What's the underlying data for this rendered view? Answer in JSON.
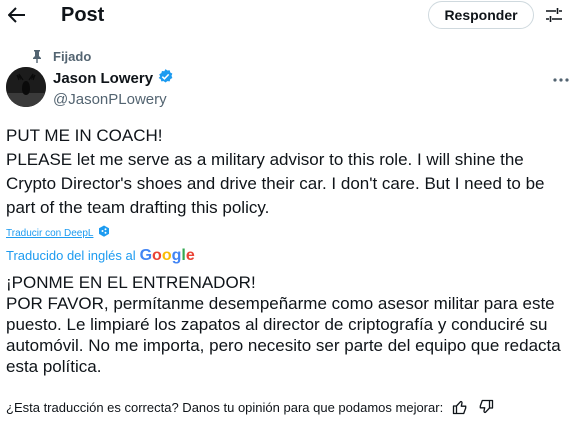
{
  "header": {
    "title": "Post",
    "reply_label": "Responder"
  },
  "pinned_label": "Fijado",
  "author": {
    "name": "Jason Lowery",
    "handle": "@JasonPLowery"
  },
  "tweet": {
    "line1": "PUT ME IN COACH!",
    "line2": "PLEASE let me serve as a military advisor to this role. I will shine the Crypto Director's shoes and drive their car. I don't care. But I need to be part of the team drafting this policy."
  },
  "translate_link": "Traducir con DeepL",
  "translated_from": "Traducido del inglés al",
  "google_logo": "Google",
  "translation": {
    "line1": "¡PONME EN EL ENTRENADOR!",
    "line2": "POR FAVOR, permítanme desempeñarme como asesor militar para este puesto. Le limpiaré los zapatos al director de criptografía y conduciré su automóvil. No me importa, pero necesito ser parte del equipo que redacta esta política."
  },
  "feedback_prompt": "¿Esta traducción es correcta? Danos tu opinión para que podamos mejorar:",
  "colors": {
    "accent": "#1d9bf0",
    "muted": "#536471",
    "text": "#0f1419",
    "border": "#cfd9de"
  },
  "icons": [
    "back-arrow-icon",
    "tune-icon",
    "pin-icon",
    "verified-badge-icon",
    "more-icon",
    "deepl-icon",
    "thumbs-up-icon",
    "thumbs-down-icon"
  ]
}
